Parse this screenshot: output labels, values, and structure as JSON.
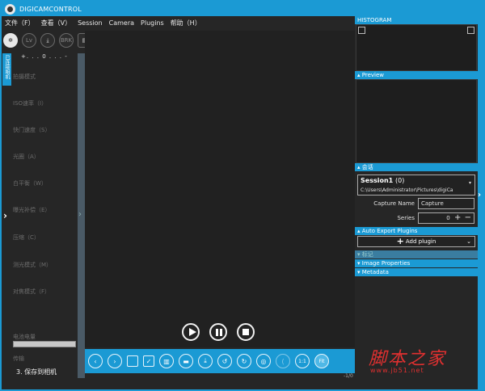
{
  "window": {
    "title": "DIGICAMCONTROL"
  },
  "menu": [
    "文件（F）",
    "查看（V）",
    "Session",
    "Camera",
    "Plugins",
    "帮助（H）"
  ],
  "toolbar": {
    "lv_label": "Lv",
    "brk_label": "BRK",
    "b_label": "B"
  },
  "left_panel": {
    "tab_label": "已连接相机",
    "exposure_scale": "+. . . 0 . . . -",
    "properties": [
      "拍摄模式",
      "ISO速率（I）",
      "快门速度（S）",
      "光圈（A）",
      "白平衡（W）",
      "曝光补偿（E）",
      "压缩（C）",
      "测光模式（M）",
      "对焦模式（F）"
    ],
    "battery_label": "电池电量",
    "transfer_label": "传输",
    "transfer_value": "3. 保存到相机"
  },
  "bottom_bar": {
    "zoom_label": "1:1",
    "fit_label": "Fit",
    "page_indicator": "-1/0"
  },
  "right_panel": {
    "histogram_header": "HISTOGRAM",
    "preview_header": "Preview",
    "session_header": "会话",
    "session": {
      "name": "Session1",
      "count": "(0)",
      "path": "C:\\Users\\Administrator\\Pictures\\digiCa"
    },
    "capture_name_label": "Capture Name",
    "capture_name_value": "Capture",
    "series_label": "Series",
    "series_value": "0",
    "auto_export_header": "Auto Export Plugins",
    "add_plugin_label": "Add plugin",
    "tag_header": "标记",
    "image_properties_header": "Image Properties",
    "metadata_header": "Metadata"
  },
  "watermark": {
    "text": "脚本之家",
    "url": "www.jb51.net"
  },
  "colors": {
    "accent": "#1b9ad4",
    "background": "#262626",
    "watermark": "#e03030"
  }
}
